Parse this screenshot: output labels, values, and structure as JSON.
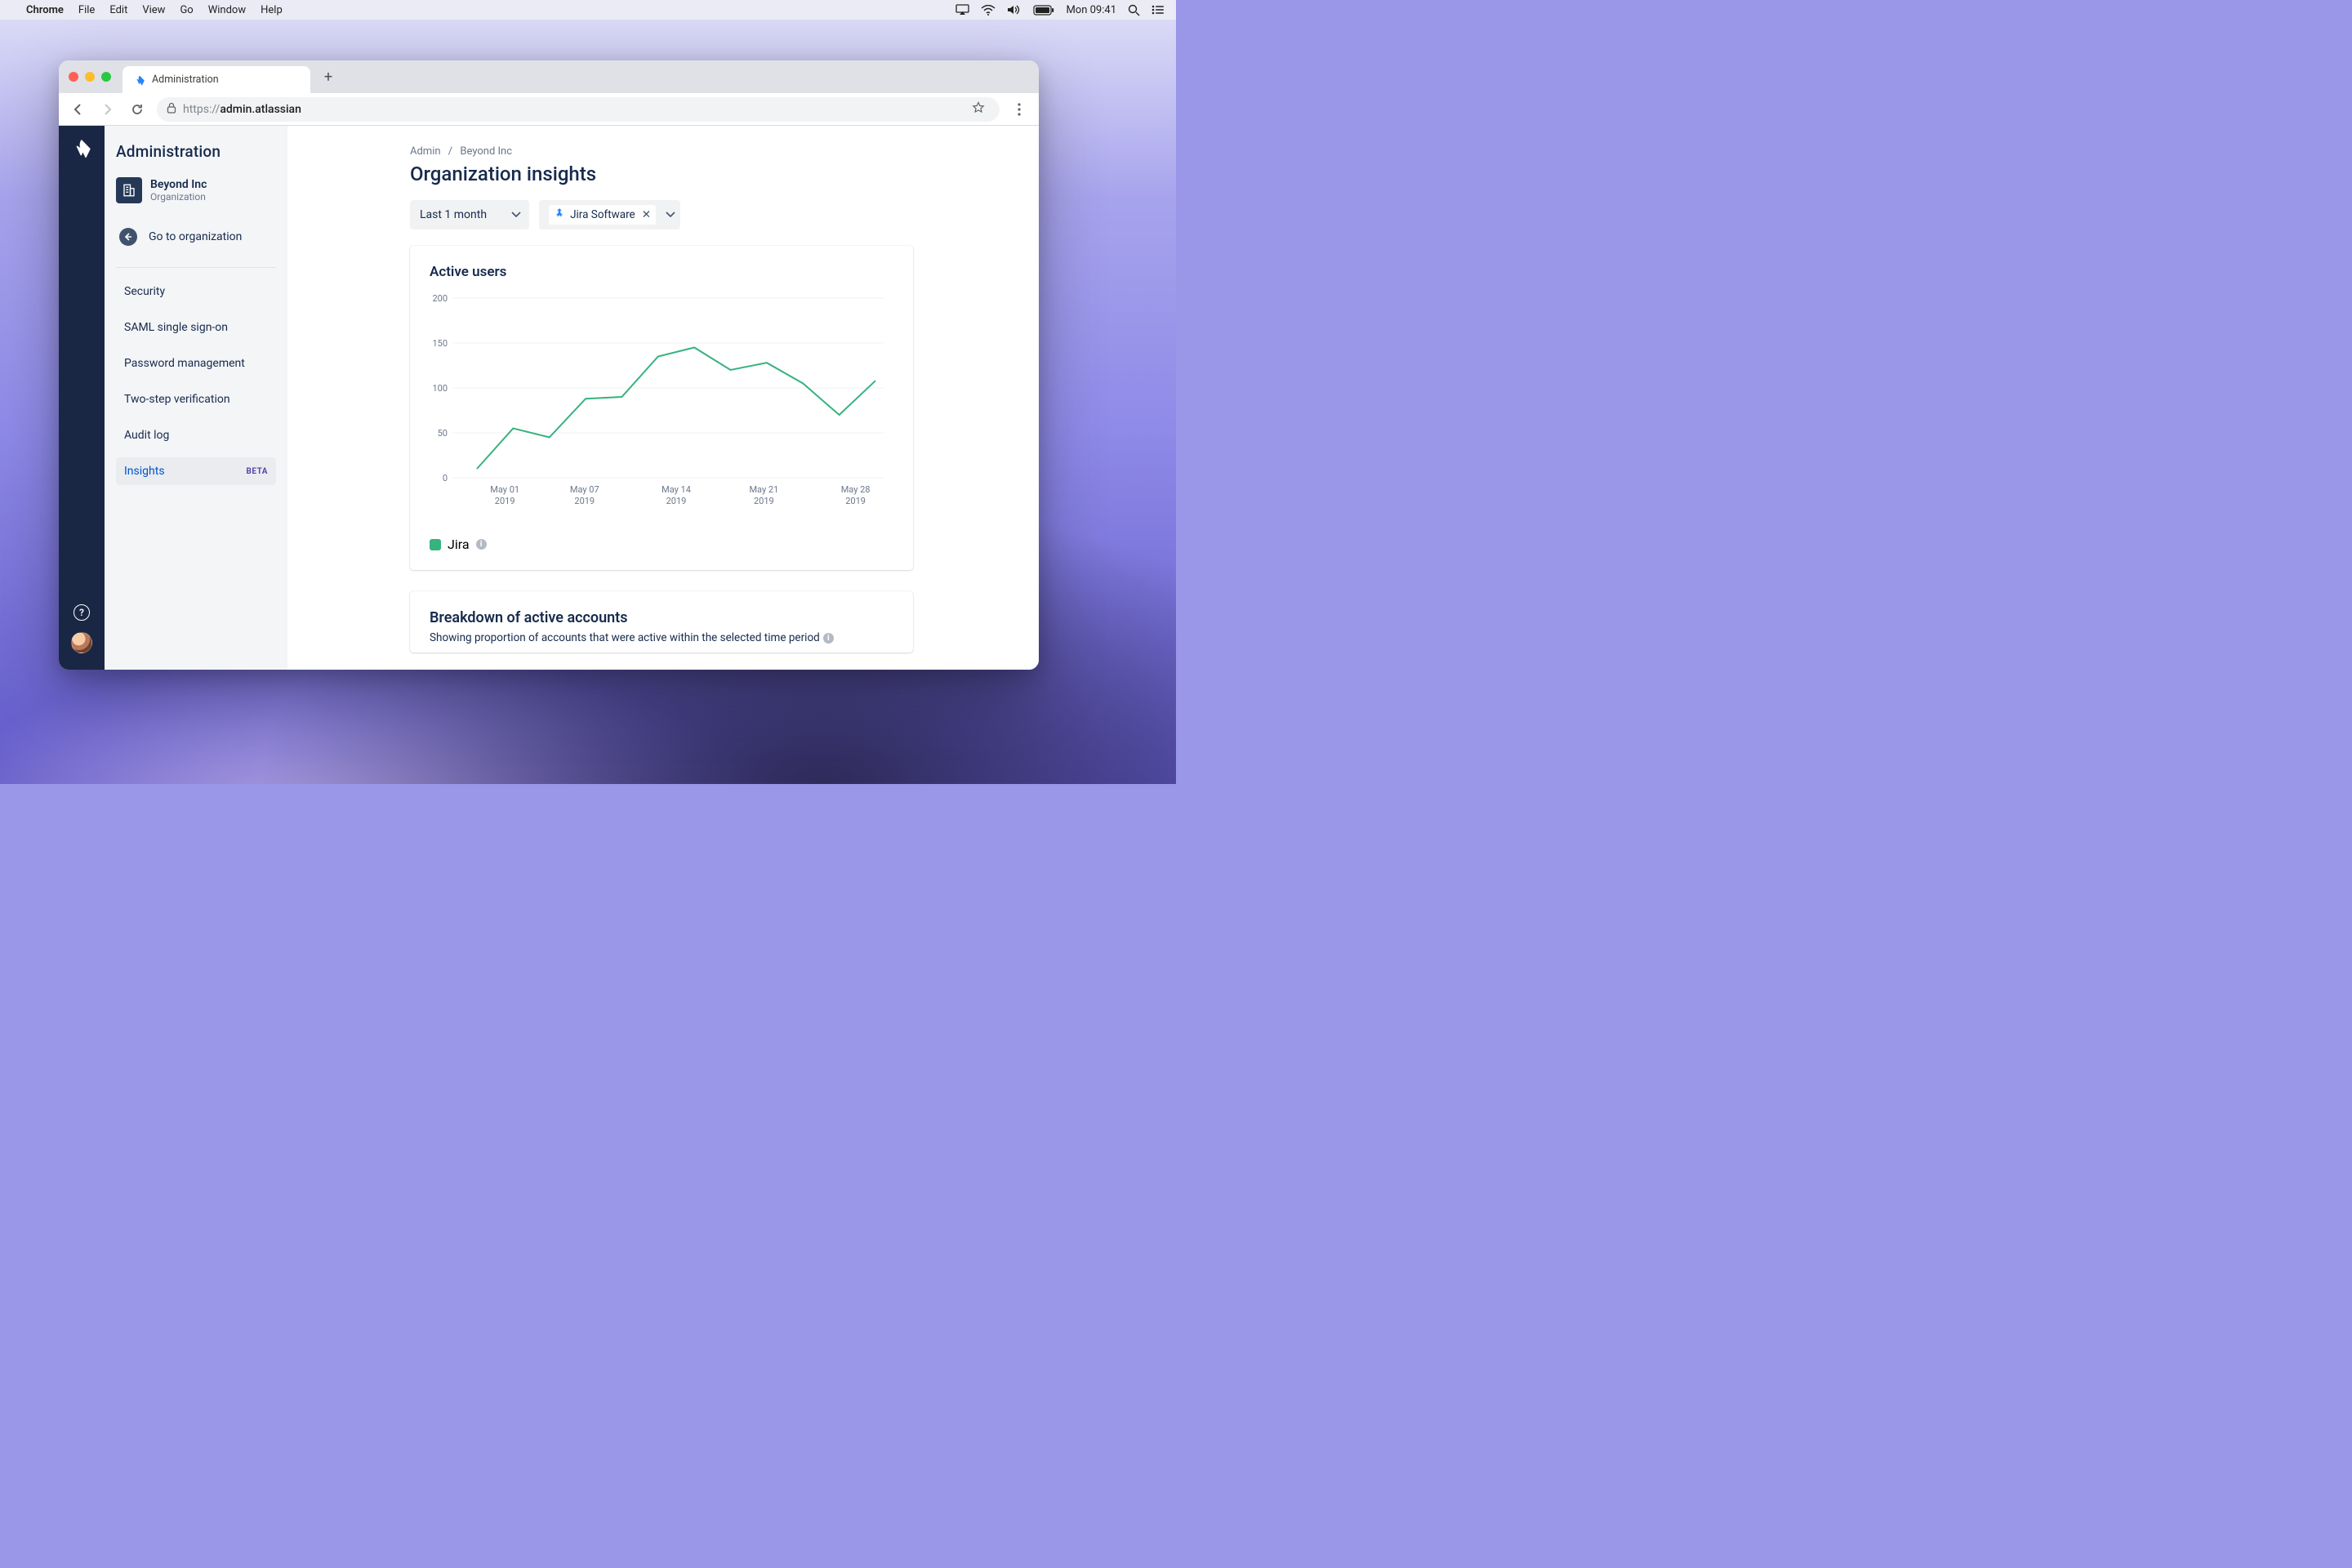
{
  "mac_menu": {
    "app": "Chrome",
    "items": [
      "File",
      "Edit",
      "View",
      "Go",
      "Window",
      "Help"
    ],
    "clock": "Mon 09:41"
  },
  "browser": {
    "tab_title": "Administration",
    "url_display_prefix": "https://",
    "url_display_host": "admin.atlassian"
  },
  "sidebar": {
    "title": "Administration",
    "org_name": "Beyond Inc",
    "org_sub": "Organization",
    "go_to_org": "Go to organization",
    "items": [
      {
        "label": "Security"
      },
      {
        "label": "SAML single sign-on"
      },
      {
        "label": "Password management"
      },
      {
        "label": "Two-step verification"
      },
      {
        "label": "Audit log"
      },
      {
        "label": "Insights",
        "badge": "BETA"
      }
    ]
  },
  "breadcrumb": {
    "root": "Admin",
    "leaf": "Beyond Inc"
  },
  "page_title": "Organization insights",
  "filters": {
    "range": "Last 1 month",
    "product": "Jira Software"
  },
  "card1_title": "Active users",
  "chart_data": {
    "type": "line",
    "title": "Active users",
    "xlabel": "",
    "ylabel": "",
    "ylim": [
      0,
      200
    ],
    "y_ticks": [
      0,
      50,
      100,
      150,
      200
    ],
    "x_tick_labels": [
      [
        "May 01",
        "2019"
      ],
      [
        "May 07",
        "2019"
      ],
      [
        "May 14",
        "2019"
      ],
      [
        "May 21",
        "2019"
      ],
      [
        "May 28",
        "2019"
      ]
    ],
    "series": [
      {
        "name": "Jira",
        "color": "#36b37e",
        "x": [
          "2019-04-30",
          "2019-05-02",
          "2019-05-05",
          "2019-05-07",
          "2019-05-10",
          "2019-05-12",
          "2019-05-14",
          "2019-05-16",
          "2019-05-18",
          "2019-05-21",
          "2019-05-24",
          "2019-05-28"
        ],
        "values": [
          10,
          55,
          45,
          88,
          90,
          135,
          145,
          120,
          128,
          105,
          70,
          108
        ]
      }
    ]
  },
  "legend_label": "Jira",
  "card2_title": "Breakdown of active accounts",
  "card2_text": "Showing proportion of accounts that were active within the selected time period"
}
